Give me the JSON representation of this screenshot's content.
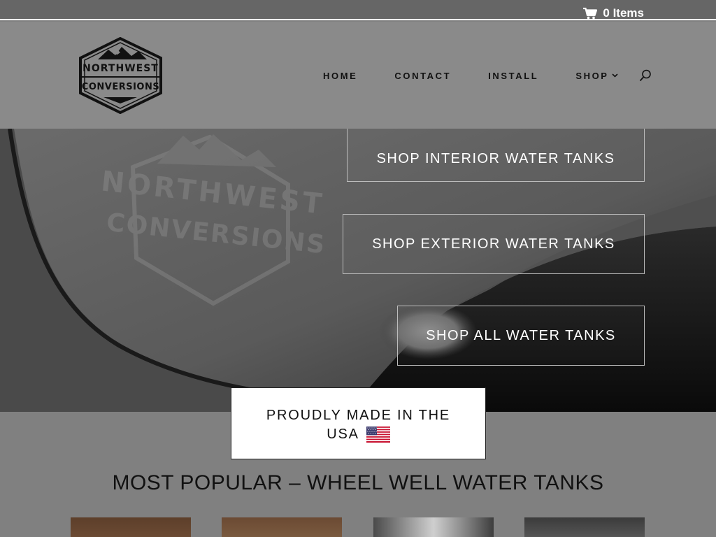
{
  "topbar": {
    "cart_icon": "shopping-cart-icon",
    "cart_label": "0 Items"
  },
  "header": {
    "logo": {
      "line1": "NORTHWEST",
      "line2": "CONVERSIONS"
    },
    "nav": [
      {
        "label": "HOME"
      },
      {
        "label": "CONTACT"
      },
      {
        "label": "INSTALL"
      },
      {
        "label": "SHOP"
      }
    ],
    "search_icon": "search-icon"
  },
  "hero": {
    "watermark_line1": "NORTHWEST",
    "watermark_line2": "CONVERSIONS",
    "buttons": [
      {
        "label": "SHOP INTERIOR WATER TANKS"
      },
      {
        "label": "SHOP EXTERIOR WATER TANKS"
      },
      {
        "label": "SHOP ALL WATER TANKS"
      }
    ]
  },
  "usa_badge": {
    "line1": "PROUDLY MADE IN THE",
    "line2": "USA",
    "flag_icon": "us-flag-icon"
  },
  "popular": {
    "title": "MOST POPULAR – WHEEL WELL WATER TANKS"
  },
  "colors": {
    "topbar": "#666666",
    "header_bg": "#8a8a8a",
    "page_bg": "#808080",
    "text_dark": "#111111"
  }
}
